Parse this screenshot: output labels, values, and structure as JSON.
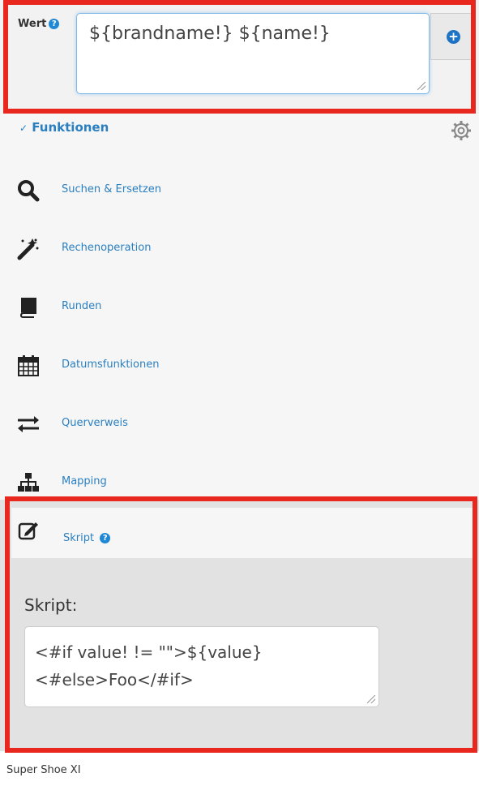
{
  "wert": {
    "label": "Wert",
    "help": "?",
    "value": "${brandname!} ${name!}",
    "add_icon": "plus-circle-icon"
  },
  "functions": {
    "header": "Funktionen",
    "settings_icon": "gear-icon",
    "items": [
      {
        "label": "Suchen & Ersetzen",
        "icon": "search-icon"
      },
      {
        "label": "Rechenoperation",
        "icon": "magic-wand-icon"
      },
      {
        "label": "Runden",
        "icon": "book-icon"
      },
      {
        "label": "Datumsfunktionen",
        "icon": "calendar-icon"
      },
      {
        "label": "Querverweis",
        "icon": "exchange-icon"
      },
      {
        "label": "Mapping",
        "icon": "sitemap-icon"
      }
    ]
  },
  "skript": {
    "tab_label": "Skript",
    "help": "?",
    "field_label": "Skript:",
    "value_line1": "<#if value! != \"\">${value}",
    "value_line2": "<#else>Foo</#if>"
  },
  "footer": {
    "text": "Super Shoe XI"
  },
  "colors": {
    "accent": "#2a7fc1",
    "highlight": "#e8271f"
  }
}
